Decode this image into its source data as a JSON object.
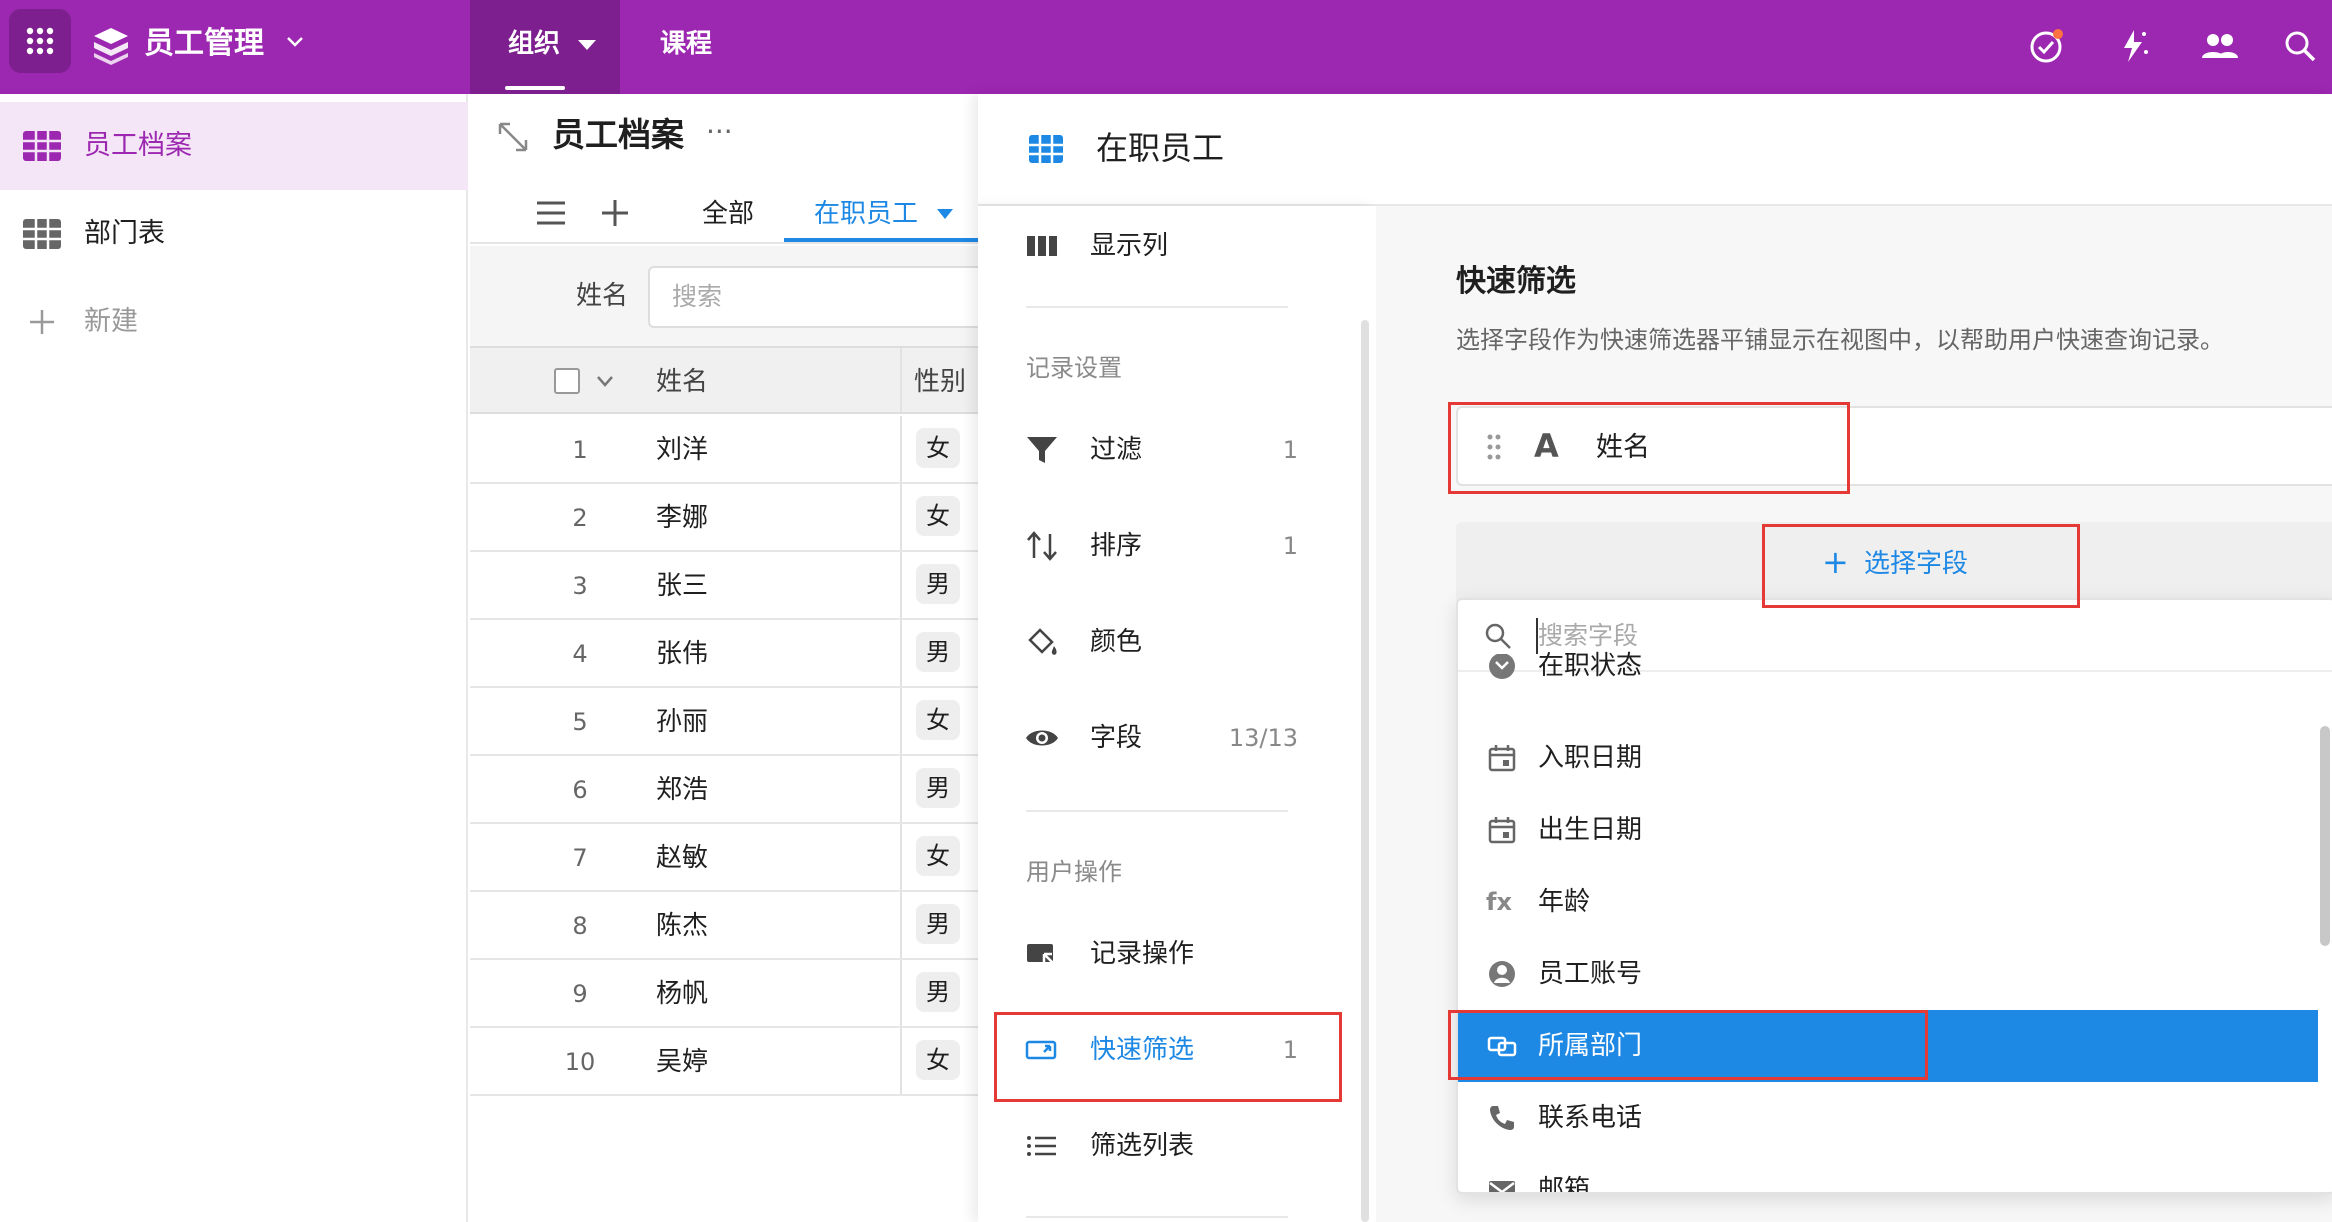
{
  "topbar": {
    "app_title": "员工管理",
    "tabs": [
      {
        "label": "组织",
        "active": true
      },
      {
        "label": "课程",
        "active": false
      }
    ],
    "bg_color": "#9c27b0",
    "icons": [
      "check-circle-icon",
      "magic-icon",
      "people-icon",
      "search-icon"
    ]
  },
  "sidebar": {
    "items": [
      {
        "label": "员工档案",
        "active": true
      },
      {
        "label": "部门表",
        "active": false
      },
      {
        "label": "新建",
        "active": false
      }
    ]
  },
  "table": {
    "title": "员工档案",
    "views": [
      {
        "label": "全部"
      },
      {
        "label": "在职员工",
        "active": true
      }
    ],
    "filter_label": "姓名",
    "search_placeholder": "搜索",
    "columns": [
      "姓名",
      "性别"
    ],
    "rows": [
      {
        "num": "1",
        "name": "刘洋",
        "gender": "女"
      },
      {
        "num": "2",
        "name": "李娜",
        "gender": "女"
      },
      {
        "num": "3",
        "name": "张三",
        "gender": "男"
      },
      {
        "num": "4",
        "name": "张伟",
        "gender": "男"
      },
      {
        "num": "5",
        "name": "孙丽",
        "gender": "女"
      },
      {
        "num": "6",
        "name": "郑浩",
        "gender": "男"
      },
      {
        "num": "7",
        "name": "赵敏",
        "gender": "女"
      },
      {
        "num": "8",
        "name": "陈杰",
        "gender": "男"
      },
      {
        "num": "9",
        "name": "杨帆",
        "gender": "男"
      },
      {
        "num": "10",
        "name": "吴婷",
        "gender": "女"
      }
    ]
  },
  "panel": {
    "title": "在职员工",
    "menu": {
      "display_columns": "显示列",
      "section_record": "记录设置",
      "filter": {
        "label": "过滤",
        "count": "1"
      },
      "sort": {
        "label": "排序",
        "count": "1"
      },
      "color": {
        "label": "颜色"
      },
      "fields": {
        "label": "字段",
        "count": "13/13"
      },
      "section_user": "用户操作",
      "record_action": {
        "label": "记录操作"
      },
      "quick_filter": {
        "label": "快速筛选",
        "count": "1"
      },
      "filter_list": {
        "label": "筛选列表"
      }
    },
    "main": {
      "title": "快速筛选",
      "description": "选择字段作为快速筛选器平铺显示在视图中，以帮助用户快速查询记录。",
      "field": {
        "type_glyph": "A",
        "name": "姓名"
      },
      "add_field_label": "选择字段"
    },
    "dropdown": {
      "search_placeholder": "搜索字段",
      "items": [
        {
          "label": "在职状态",
          "icon": "status-icon"
        },
        {
          "label": "入职日期",
          "icon": "calendar-icon"
        },
        {
          "label": "出生日期",
          "icon": "calendar-icon"
        },
        {
          "label": "年龄",
          "icon": "formula-icon",
          "glyph": "fx"
        },
        {
          "label": "员工账号",
          "icon": "user-circle-icon"
        },
        {
          "label": "所属部门",
          "icon": "link-icon",
          "selected": true
        },
        {
          "label": "联系电话",
          "icon": "phone-icon"
        },
        {
          "label": "邮箱",
          "icon": "mail-icon"
        }
      ]
    }
  },
  "colors": {
    "brand": "#9c27b0",
    "accent": "#1e88e5",
    "highlight": "#e53935"
  }
}
